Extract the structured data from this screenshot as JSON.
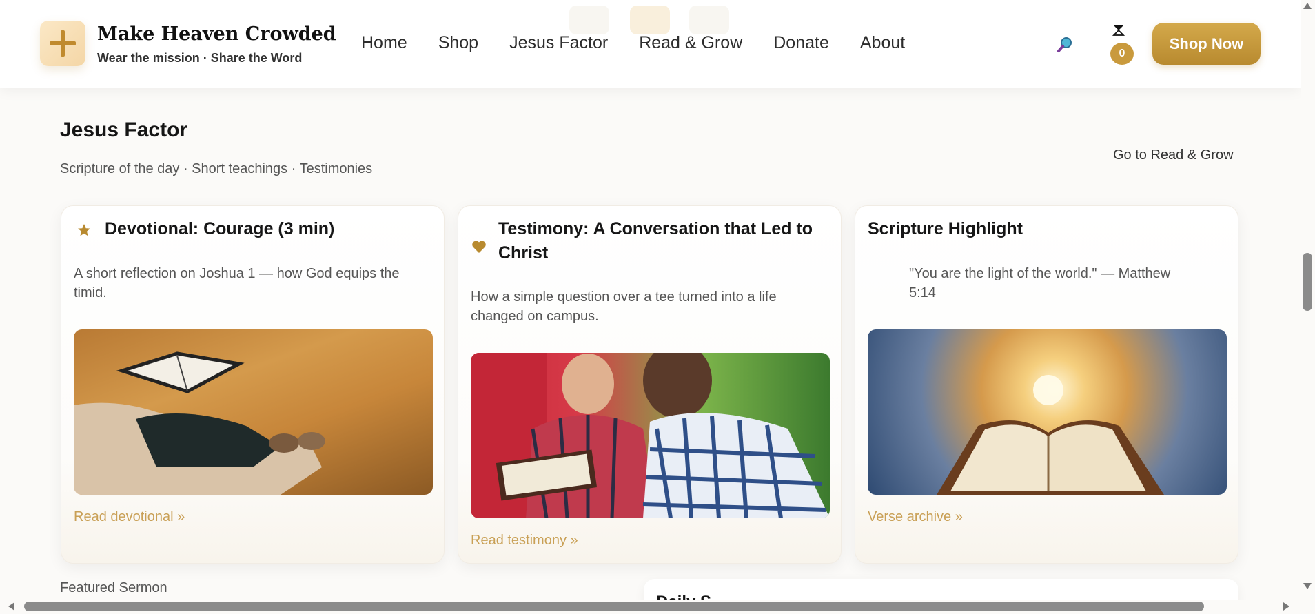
{
  "brand": {
    "title": "Make Heaven Crowded",
    "tagline": "Wear the mission · Share the Word",
    "logo_icon": "plus-cross-icon",
    "accent_color": "#c99a3d"
  },
  "nav": {
    "items": [
      {
        "label": "Home"
      },
      {
        "label": "Shop"
      },
      {
        "label": "Jesus Factor"
      },
      {
        "label": "Read & Grow"
      },
      {
        "label": "Donate"
      },
      {
        "label": "About"
      }
    ]
  },
  "header_actions": {
    "search_icon": "magnifier-icon",
    "cart_icon": "hourglass-cart-icon",
    "cart_count": "0",
    "shop_now_label": "Shop Now"
  },
  "section": {
    "title": "Jesus Factor",
    "subtitle": "Scripture of the day · Short teachings · Testimonies",
    "side_link": "Go to Read & Grow"
  },
  "cards": [
    {
      "icon": "star-icon",
      "title": "Devotional: Courage (3 min)",
      "text": "A short reflection on Joshua 1 — how God equips the timid.",
      "image": "person-reading-bible-in-autumn-grass",
      "link": "Read devotional »"
    },
    {
      "icon": "heart-icon",
      "title": "Testimony: A Conversation that Led to Christ",
      "text": "How a simple question over a tee turned into a life changed on campus.",
      "image": "two-men-reading-bible-together",
      "link": "Read testimony »"
    },
    {
      "icon": "",
      "title": "Scripture Highlight",
      "text": "\"You are the light of the world.\" — Matthew 5:14",
      "image": "open-bible-under-sunlit-sky",
      "link": "Verse archive »"
    }
  ],
  "bottom": {
    "featured_label": "Featured Sermon",
    "partial_heading": "Daily S"
  },
  "colors": {
    "page_bg": "#fbfaf8",
    "link_gold": "#c9a056",
    "button_gold": "#c99a3d"
  }
}
